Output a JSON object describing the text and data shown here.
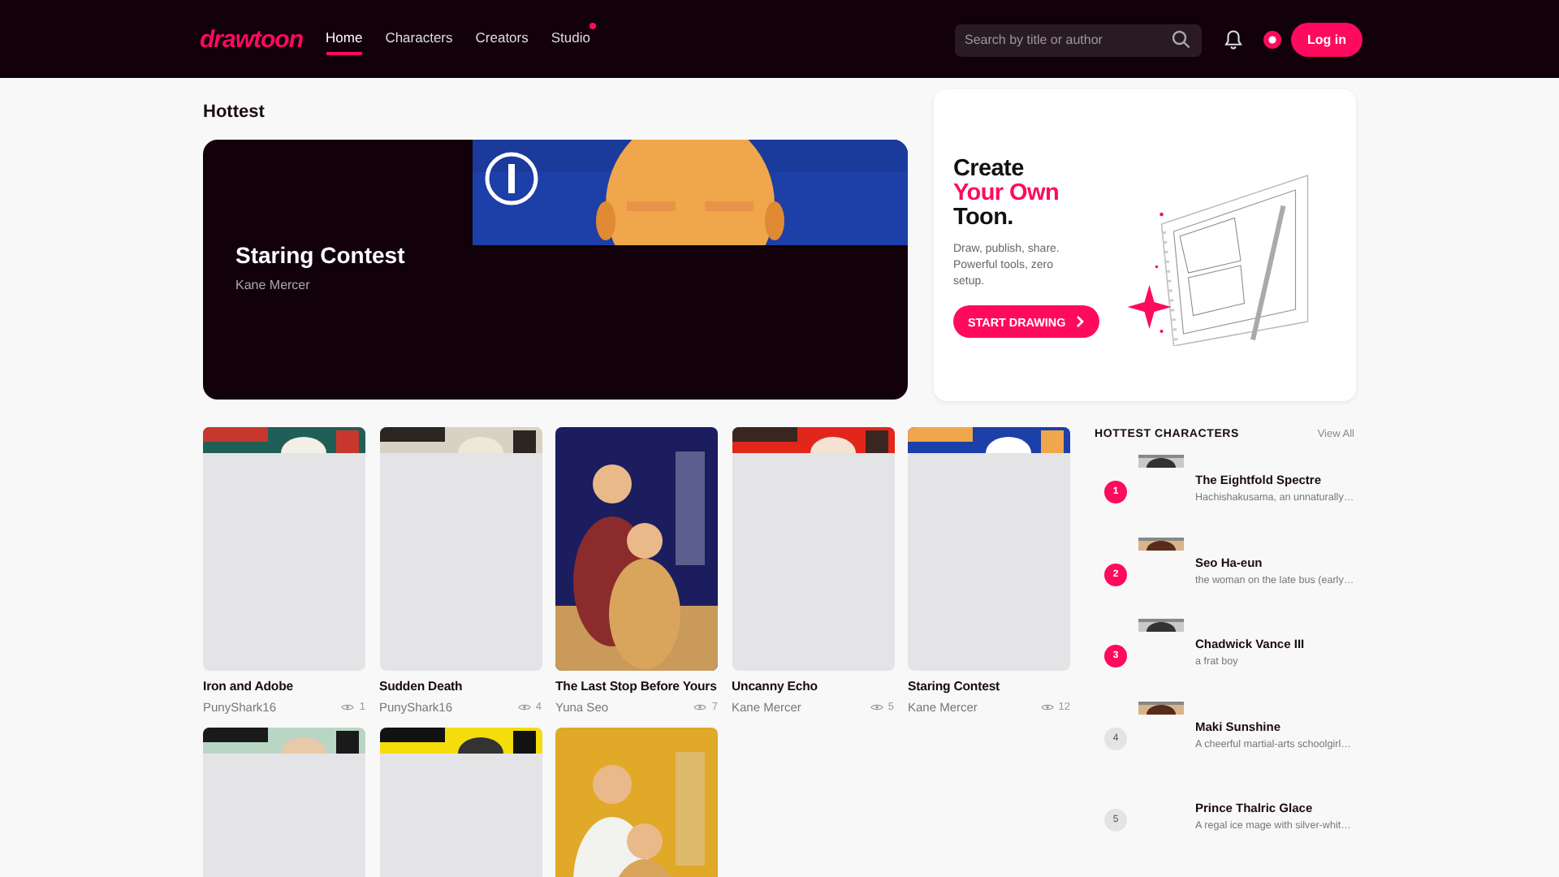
{
  "header": {
    "logo": "drawtoon",
    "nav": [
      {
        "label": "Home",
        "selected": true,
        "badge": false
      },
      {
        "label": "Characters",
        "selected": false,
        "badge": false
      },
      {
        "label": "Creators",
        "selected": false,
        "badge": false
      },
      {
        "label": "Studio",
        "selected": false,
        "badge": true
      }
    ],
    "search": {
      "placeholder": "Search by title or author"
    },
    "login": "Log in"
  },
  "hottest": {
    "heading": "Hottest",
    "feature": {
      "title": "Staring Contest",
      "author": "Kane Mercer"
    }
  },
  "promo": {
    "title_lines": [
      {
        "text": "Create",
        "accent": false
      },
      {
        "text": "Your Own",
        "accent": true
      },
      {
        "text": "Toon.",
        "accent": false
      }
    ],
    "text": "Draw, publish, share. Powerful tools, zero setup.",
    "button": "START DRAWING"
  },
  "comics": [
    {
      "title": "Iron and Adobe",
      "author": "PunyShark16",
      "views": "1",
      "loaded": false
    },
    {
      "title": "Sudden Death",
      "author": "PunyShark16",
      "views": "4",
      "loaded": false
    },
    {
      "title": "The Last Stop Before Yours",
      "author": "Yuna Seo",
      "views": "7",
      "loaded": true
    },
    {
      "title": "Uncanny Echo",
      "author": "Kane Mercer",
      "views": "5",
      "loaded": false
    },
    {
      "title": "Staring Contest",
      "author": "Kane Mercer",
      "views": "12",
      "loaded": false
    },
    {
      "loaded": false
    },
    {
      "loaded": false
    },
    {
      "loaded": true
    }
  ],
  "characters": {
    "heading": "HOTTEST CHARACTERS",
    "view_all": "View All",
    "items": [
      {
        "rank": "1",
        "top": true,
        "thumb": true,
        "name": "The Eightfold Spectre",
        "desc": "Hachishakusama, an unnaturally…"
      },
      {
        "rank": "2",
        "top": true,
        "thumb": true,
        "name": "Seo Ha-eun",
        "desc": "the woman on the late bus (early…"
      },
      {
        "rank": "3",
        "top": true,
        "thumb": true,
        "name": "Chadwick Vance III",
        "desc": "a frat boy"
      },
      {
        "rank": "4",
        "top": false,
        "thumb": true,
        "name": "Maki Sunshine",
        "desc": "A cheerful martial-arts schoolgirl…"
      },
      {
        "rank": "5",
        "top": false,
        "thumb": false,
        "name": "Prince Thalric Glace",
        "desc": "A regal ice mage with silver-whit…"
      }
    ]
  }
}
